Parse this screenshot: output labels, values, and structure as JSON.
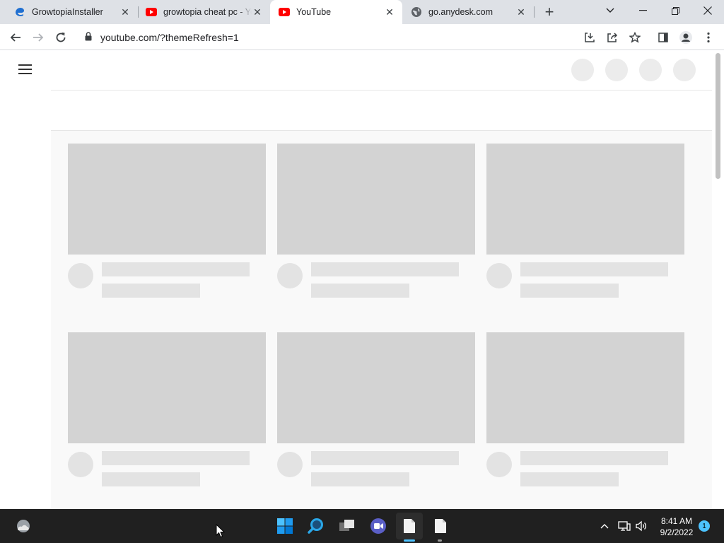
{
  "browser": {
    "tabs": [
      {
        "title": "GrowtopiaInstaller",
        "favicon": "edge-installer-icon",
        "active": false
      },
      {
        "title": "growtopia cheat pc - YouTube",
        "favicon": "youtube-icon",
        "active": false
      },
      {
        "title": "YouTube",
        "favicon": "youtube-icon",
        "active": true
      },
      {
        "title": "go.anydesk.com",
        "favicon": "globe-icon",
        "active": false
      }
    ],
    "new_tab_label": "+",
    "address_bar": {
      "url": "youtube.com/?themeRefresh=1"
    }
  },
  "taskbar": {
    "clock": {
      "time": "8:41 AM",
      "date": "9/2/2022"
    },
    "notification_count": "1"
  },
  "colors": {
    "youtube_red": "#ff0000",
    "skeleton_thumb": "#d3d3d3",
    "skeleton_text": "#e3e3e3",
    "taskbar_bg": "#202020",
    "accent": "#4cc2ff"
  }
}
